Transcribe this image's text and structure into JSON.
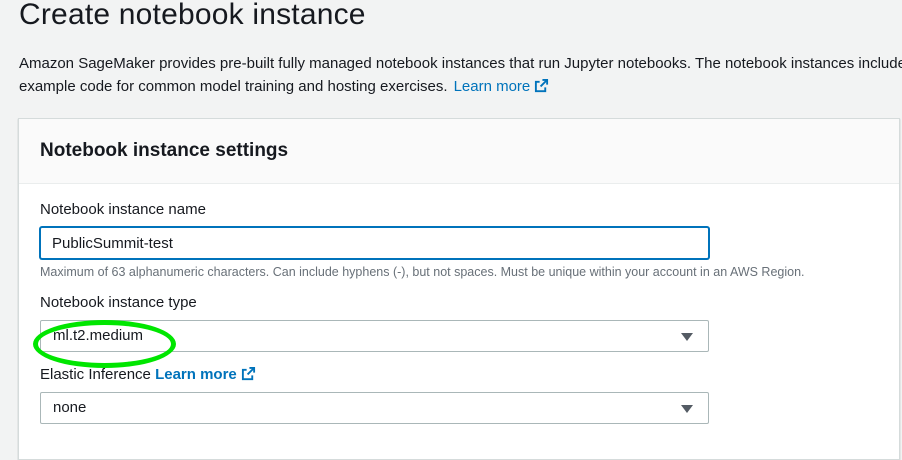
{
  "page": {
    "title": "Create notebook instance",
    "description": "Amazon SageMaker provides pre-built fully managed notebook instances that run Jupyter notebooks. The notebook instances include example code for common model training and hosting exercises.",
    "learn_more": "Learn more"
  },
  "settings": {
    "title": "Notebook instance settings",
    "name_label": "Notebook instance name",
    "name_value": "PublicSummit-test",
    "name_hint": "Maximum of 63 alphanumeric characters. Can include hyphens (-), but not spaces. Must be unique within your account in an AWS Region.",
    "type_label": "Notebook instance type",
    "type_value": "ml.t2.medium",
    "ei_label": "Elastic Inference",
    "ei_learn_more": "Learn more",
    "ei_value": "none"
  },
  "icons": {
    "external_link": "external-link-icon",
    "dropdown": "caret-down-icon"
  },
  "colors": {
    "link": "#0073bb",
    "highlight": "#00e600",
    "focus_border": "#0073bb"
  }
}
